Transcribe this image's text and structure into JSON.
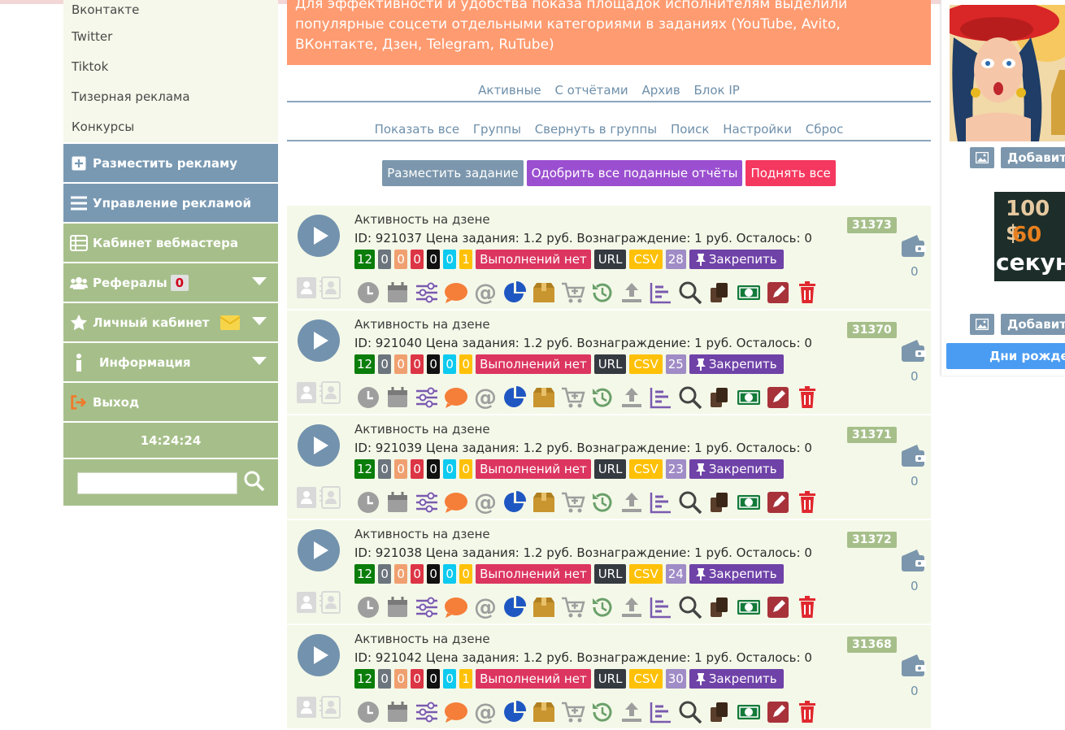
{
  "sidebar": {
    "links": [
      "Вконтакте",
      "Twitter",
      "Tiktok",
      "Тизерная реклама",
      "Конкурсы"
    ],
    "place_ad": "Разместить рекламу",
    "manage_ad": "Управление рекламой",
    "webmaster": "Кабинет вебмастера",
    "referrals": "Рефералы",
    "referrals_count": "0",
    "account": "Личный кабинет",
    "info": "Информация",
    "logout": "Выход",
    "clock": "14:24:24",
    "search_value": ""
  },
  "notice": {
    "text": "Для эффективности и удобства показа площадок исполнителям выделили популярные соцсети отдельными категориями в заданиях (YouTube, Avito, ВКонтакте, Дзен, Telegram, RuTube)"
  },
  "nav1": [
    "Активные",
    "С отчётами",
    "Архив",
    "Блок IP"
  ],
  "nav2": [
    "Показать все",
    "Группы",
    "Свернуть в группы",
    "Поиск",
    "Настройки",
    "Сброс"
  ],
  "actions": {
    "place_task": "Разместить задание",
    "approve_all": "Одобрить все поданные отчёты",
    "raise_all": "Поднять все"
  },
  "labels": {
    "no_executions": "Выполнений нет",
    "url": "URL",
    "csv": "CSV",
    "pin": "Закрепить"
  },
  "tasks": [
    {
      "title": "Активность на дзене",
      "info": "ID: 921037 Цена задания: 1.2 руб. Вознаграждение: 1 руб. Осталось: 0",
      "badge": "31373",
      "counts": [
        "12",
        "0",
        "0",
        "0",
        "0",
        "0",
        "1"
      ],
      "num": "28",
      "wallet": "0"
    },
    {
      "title": "Активность на дзене",
      "info": "ID: 921040 Цена задания: 1.2 руб. Вознаграждение: 1 руб. Осталось: 0",
      "badge": "31370",
      "counts": [
        "12",
        "0",
        "0",
        "0",
        "0",
        "0",
        "0"
      ],
      "num": "25",
      "wallet": "0"
    },
    {
      "title": "Активность на дзене",
      "info": "ID: 921039 Цена задания: 1.2 руб. Вознаграждение: 1 руб. Осталось: 0",
      "badge": "31371",
      "counts": [
        "12",
        "0",
        "0",
        "0",
        "0",
        "0",
        "0"
      ],
      "num": "23",
      "wallet": "0"
    },
    {
      "title": "Активность на дзене",
      "info": "ID: 921038 Цена задания: 1.2 руб. Вознаграждение: 1 руб. Осталось: 0",
      "badge": "31372",
      "counts": [
        "12",
        "0",
        "0",
        "0",
        "0",
        "0",
        "0"
      ],
      "num": "24",
      "wallet": "0"
    },
    {
      "title": "Активность на дзене",
      "info": "ID: 921042 Цена задания: 1.2 руб. Вознаграждение: 1 руб. Осталось: 0",
      "badge": "31368",
      "counts": [
        "12",
        "0",
        "0",
        "0",
        "0",
        "0",
        "1"
      ],
      "num": "30",
      "wallet": "0"
    }
  ],
  "right": {
    "add_label": "Добавить",
    "promo_line1": "100 $",
    "promo_line2": "60",
    "promo_line3": "секун",
    "birthdays": "Дни рождения"
  },
  "colors": {
    "sidebar_blue": "#7999b3",
    "sidebar_green": "#a6bf8a",
    "notice": "#fe9b70",
    "place_task": "#7c97ad",
    "approve_all": "#9b4fd0",
    "raise_all": "#f5385f"
  }
}
